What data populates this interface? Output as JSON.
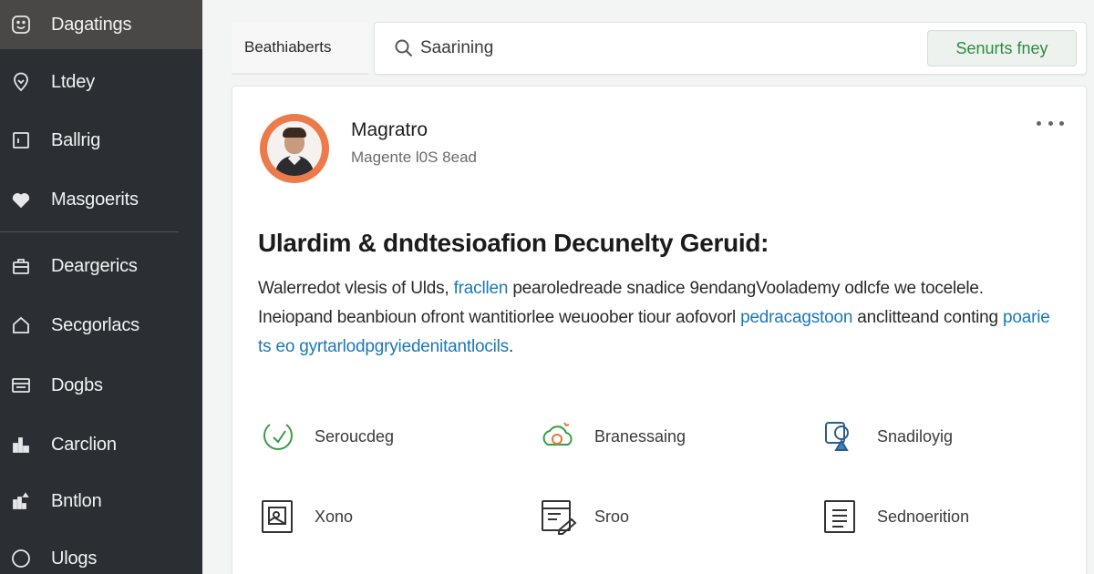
{
  "sidebar": {
    "items": [
      {
        "label": "Dagatings",
        "icon": "face-icon",
        "active": true
      },
      {
        "label": "Ltdey",
        "icon": "location-pin-icon"
      },
      {
        "label": "Ballrig",
        "icon": "calendar-icon"
      },
      {
        "label": "Masgoerits",
        "icon": "heart-icon"
      },
      {
        "label": "Deargerics",
        "icon": "briefcase-icon"
      },
      {
        "label": "Secgorlacs",
        "icon": "home-icon"
      },
      {
        "label": "Dogbs",
        "icon": "list-icon"
      },
      {
        "label": "Carclion",
        "icon": "chart-icon"
      },
      {
        "label": "Bntlon",
        "icon": "chart-up-icon"
      },
      {
        "label": "Ulogs",
        "icon": "circle-icon"
      }
    ]
  },
  "header": {
    "tab_label": "Beathiaberts",
    "search_placeholder": "Saarining",
    "action_label": "Senurts fney"
  },
  "profile": {
    "name": "Magratro",
    "subtitle": "Magente l0S 8ead"
  },
  "article": {
    "title": "Ulardim & dndtesioafion Decunelty Geruid:",
    "body_1": "Walerredot vlesis of Ulds, ",
    "link_1": "fracllen",
    "body_2": " pearoledreade snadice 9endangVoolademy odlcfe we tocelele. Ineiopand beanbioun ofront wantitiorlee weuoober tiour aofovorl ",
    "link_2": "pedracagstoon",
    "body_3": " anclitteand conting ",
    "link_3": "poarie ts eo gyrtarlodpgryiedenitantlocils",
    "body_4": "."
  },
  "features": [
    {
      "label": "Seroucdeg",
      "icon": "check-icon",
      "color": "#3a9a48"
    },
    {
      "label": "Branessaing",
      "icon": "cloud-sync-icon",
      "color": "#3a9a48"
    },
    {
      "label": "Snadiloyig",
      "icon": "user-shield-icon",
      "color": "#2a5d8a"
    },
    {
      "label": "Xono",
      "icon": "image-frame-icon",
      "color": "#333333"
    },
    {
      "label": "Sroo",
      "icon": "document-edit-icon",
      "color": "#333333"
    },
    {
      "label": "Sednoerition",
      "icon": "document-icon",
      "color": "#333333"
    }
  ],
  "colors": {
    "sidebar_bg": "#2b2f33",
    "sidebar_active": "#4a4846",
    "accent_green": "#2f8a3e",
    "link_blue": "#1a78b8",
    "avatar_ring": "#ec7a4a"
  }
}
